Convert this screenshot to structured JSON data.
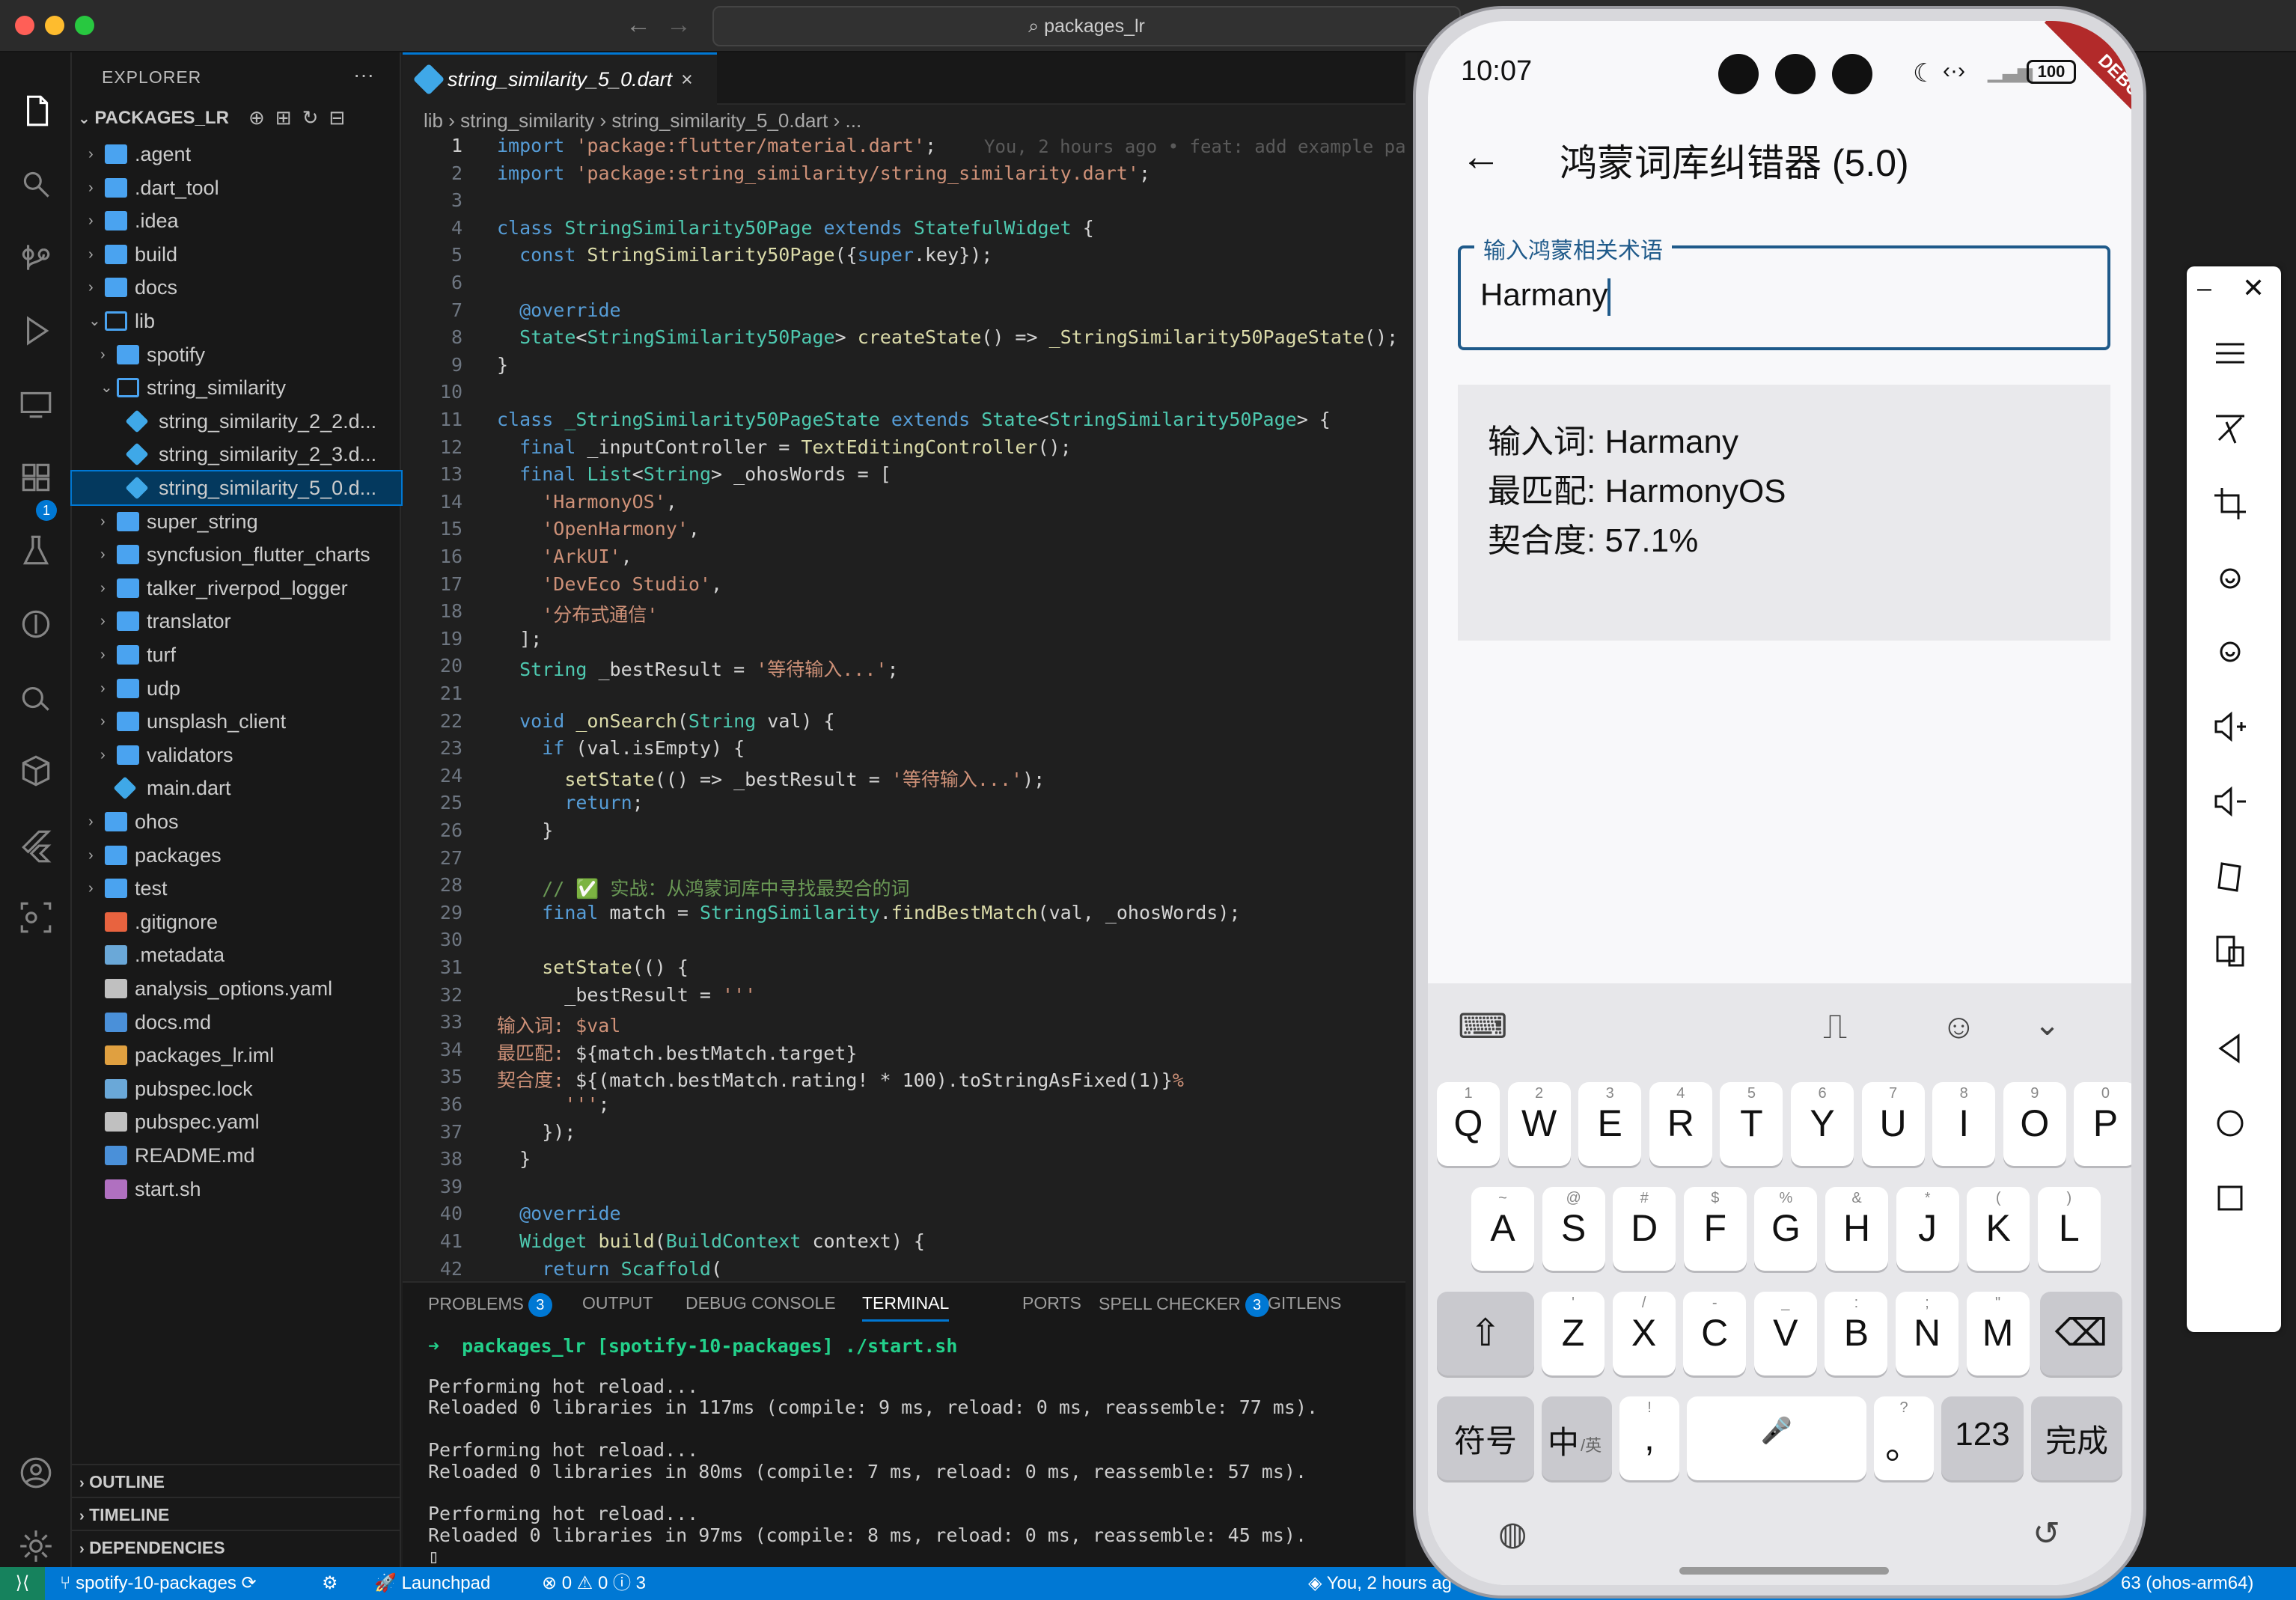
{
  "window": {
    "search": "packages_lr"
  },
  "activity_icons": [
    "files-icon",
    "search-icon",
    "source-control-icon",
    "run-debug-icon",
    "remote-explorer-icon",
    "extensions-icon",
    "testing-icon",
    "git-lens-icon",
    "docker-icon",
    "containers-icon",
    "flutter-icon",
    "scan-icon",
    "account-icon",
    "settings-icon"
  ],
  "activity_badge": "1",
  "sidebar": {
    "title": "EXPLORER",
    "root": "PACKAGES_LR",
    "tree": [
      {
        "label": ".agent",
        "depth": 0,
        "kind": "folder",
        "open": false
      },
      {
        "label": ".dart_tool",
        "depth": 0,
        "kind": "folder",
        "open": false
      },
      {
        "label": ".idea",
        "depth": 0,
        "kind": "folder",
        "open": false
      },
      {
        "label": "build",
        "depth": 0,
        "kind": "folder-gear",
        "open": false
      },
      {
        "label": "docs",
        "depth": 0,
        "kind": "folder",
        "open": false
      },
      {
        "label": "lib",
        "depth": 0,
        "kind": "folder",
        "open": true
      },
      {
        "label": "spotify",
        "depth": 1,
        "kind": "folder",
        "open": false
      },
      {
        "label": "string_similarity",
        "depth": 1,
        "kind": "folder",
        "open": true
      },
      {
        "label": "string_similarity_2_2.d...",
        "depth": 2,
        "kind": "dart"
      },
      {
        "label": "string_similarity_2_3.d...",
        "depth": 2,
        "kind": "dart"
      },
      {
        "label": "string_similarity_5_0.d...",
        "depth": 2,
        "kind": "dart",
        "selected": true
      },
      {
        "label": "super_string",
        "depth": 1,
        "kind": "folder",
        "open": false
      },
      {
        "label": "syncfusion_flutter_charts",
        "depth": 1,
        "kind": "folder",
        "open": false
      },
      {
        "label": "talker_riverpod_logger",
        "depth": 1,
        "kind": "folder",
        "open": false
      },
      {
        "label": "translator",
        "depth": 1,
        "kind": "folder",
        "open": false
      },
      {
        "label": "turf",
        "depth": 1,
        "kind": "folder",
        "open": false
      },
      {
        "label": "udp",
        "depth": 1,
        "kind": "folder",
        "open": false
      },
      {
        "label": "unsplash_client",
        "depth": 1,
        "kind": "folder",
        "open": false
      },
      {
        "label": "validators",
        "depth": 1,
        "kind": "folder",
        "open": false
      },
      {
        "label": "main.dart",
        "depth": 1,
        "kind": "dart"
      },
      {
        "label": "ohos",
        "depth": 0,
        "kind": "folder",
        "open": false
      },
      {
        "label": "packages",
        "depth": 0,
        "kind": "folder",
        "open": false
      },
      {
        "label": "test",
        "depth": 0,
        "kind": "folder",
        "open": false
      },
      {
        "label": ".gitignore",
        "depth": 0,
        "kind": "git"
      },
      {
        "label": ".metadata",
        "depth": 0,
        "kind": "file"
      },
      {
        "label": "analysis_options.yaml",
        "depth": 0,
        "kind": "yaml"
      },
      {
        "label": "docs.md",
        "depth": 0,
        "kind": "md"
      },
      {
        "label": "packages_lr.iml",
        "depth": 0,
        "kind": "xml"
      },
      {
        "label": "pubspec.lock",
        "depth": 0,
        "kind": "file"
      },
      {
        "label": "pubspec.yaml",
        "depth": 0,
        "kind": "yaml"
      },
      {
        "label": "README.md",
        "depth": 0,
        "kind": "md"
      },
      {
        "label": "start.sh",
        "depth": 0,
        "kind": "sh"
      }
    ],
    "sections": [
      "OUTLINE",
      "TIMELINE",
      "DEPENDENCIES"
    ]
  },
  "editor": {
    "tab": "string_similarity_5_0.dart",
    "breadcrumb": [
      "lib",
      "string_similarity",
      "string_similarity_5_0.dart",
      "..."
    ],
    "blame": "You, 2 hours ago • feat: add example pa",
    "lines": [
      [
        [
          "kw",
          "import "
        ],
        [
          "str",
          "'package:flutter/material.dart'"
        ],
        [
          "",
          "; "
        ]
      ],
      [
        [
          "kw",
          "import "
        ],
        [
          "str",
          "'package:string_similarity/string_similarity.dart'"
        ],
        [
          "",
          ";"
        ]
      ],
      [],
      [
        [
          "kw",
          "class "
        ],
        [
          "ty",
          "StringSimilarity50Page "
        ],
        [
          "kw",
          "extends "
        ],
        [
          "ty",
          "StatefulWidget "
        ],
        [
          "",
          "{"
        ]
      ],
      [
        [
          "",
          "  "
        ],
        [
          "kw",
          "const "
        ],
        [
          "fn",
          "StringSimilarity50Page"
        ],
        [
          "",
          "({"
        ],
        [
          "kw",
          "super"
        ],
        [
          "",
          ".key});"
        ]
      ],
      [],
      [
        [
          "",
          "  "
        ],
        [
          "ann",
          "@override"
        ]
      ],
      [
        [
          "",
          "  "
        ],
        [
          "ty",
          "State"
        ],
        [
          "",
          "<"
        ],
        [
          "ty",
          "StringSimilarity50Page"
        ],
        [
          "",
          "> "
        ],
        [
          "fn",
          "createState"
        ],
        [
          "",
          "() => "
        ],
        [
          "fn",
          "_StringSimilarity50PageState"
        ],
        [
          "",
          "();"
        ]
      ],
      [
        [
          "",
          "}"
        ]
      ],
      [],
      [
        [
          "kw",
          "class "
        ],
        [
          "ty",
          "_StringSimilarity50PageState "
        ],
        [
          "kw",
          "extends "
        ],
        [
          "ty",
          "State"
        ],
        [
          "",
          "<"
        ],
        [
          "ty",
          "StringSimilarity50Page"
        ],
        [
          "",
          "> {"
        ]
      ],
      [
        [
          "",
          "  "
        ],
        [
          "kw",
          "final "
        ],
        [
          "",
          "_inputController = "
        ],
        [
          "fn",
          "TextEditingController"
        ],
        [
          "",
          "();"
        ]
      ],
      [
        [
          "",
          "  "
        ],
        [
          "kw",
          "final "
        ],
        [
          "ty",
          "List"
        ],
        [
          "",
          "<"
        ],
        [
          "ty",
          "String"
        ],
        [
          "",
          "> _ohosWords = ["
        ]
      ],
      [
        [
          "",
          "    "
        ],
        [
          "str",
          "'HarmonyOS'"
        ],
        [
          "",
          ","
        ]
      ],
      [
        [
          "",
          "    "
        ],
        [
          "str",
          "'OpenHarmony'"
        ],
        [
          "",
          ","
        ]
      ],
      [
        [
          "",
          "    "
        ],
        [
          "str",
          "'ArkUI'"
        ],
        [
          "",
          ","
        ]
      ],
      [
        [
          "",
          "    "
        ],
        [
          "str",
          "'DevEco Studio'"
        ],
        [
          "",
          ","
        ]
      ],
      [
        [
          "",
          "    "
        ],
        [
          "str",
          "'分布式通信'"
        ]
      ],
      [
        [
          "",
          "  ];"
        ]
      ],
      [
        [
          "",
          "  "
        ],
        [
          "ty",
          "String "
        ],
        [
          "",
          "_bestResult = "
        ],
        [
          "str",
          "'等待输入...'"
        ],
        [
          "",
          ";"
        ]
      ],
      [],
      [
        [
          "",
          "  "
        ],
        [
          "kw",
          "void "
        ],
        [
          "fn",
          "_onSearch"
        ],
        [
          "",
          "("
        ],
        [
          "ty",
          "String "
        ],
        [
          "",
          "val) {"
        ]
      ],
      [
        [
          "",
          "    "
        ],
        [
          "kw",
          "if "
        ],
        [
          "",
          "(val.isEmpty) {"
        ]
      ],
      [
        [
          "",
          "      "
        ],
        [
          "fn",
          "setState"
        ],
        [
          "",
          "(() => _bestResult = "
        ],
        [
          "str",
          "'等待输入...'"
        ],
        [
          "",
          ");"
        ]
      ],
      [
        [
          "",
          "      "
        ],
        [
          "kw",
          "return"
        ],
        [
          "",
          ";"
        ]
      ],
      [
        [
          "",
          "    }"
        ]
      ],
      [],
      [
        [
          "",
          "    "
        ],
        [
          "cm",
          "// ✅ 实战：从鸿蒙词库中寻找最契合的词"
        ]
      ],
      [
        [
          "",
          "    "
        ],
        [
          "kw",
          "final "
        ],
        [
          "",
          "match = "
        ],
        [
          "ty",
          "StringSimilarity"
        ],
        [
          "",
          "."
        ],
        [
          "fn",
          "findBestMatch"
        ],
        [
          "",
          "(val, _ohosWords);"
        ]
      ],
      [],
      [
        [
          "",
          "    "
        ],
        [
          "fn",
          "setState"
        ],
        [
          "",
          "(() {"
        ]
      ],
      [
        [
          "",
          "      _bestResult = "
        ],
        [
          "str",
          "'''"
        ]
      ],
      [
        [
          "str",
          "输入词: $val"
        ]
      ],
      [
        [
          "str",
          "最匹配: "
        ],
        [
          "",
          "${match.bestMatch.target}"
        ]
      ],
      [
        [
          "str",
          "契合度: "
        ],
        [
          "",
          "${(match.bestMatch.rating! * 100).toStringAsFixed(1)}"
        ],
        [
          "str",
          "%"
        ]
      ],
      [
        [
          "",
          "      "
        ],
        [
          "str",
          "'''"
        ],
        [
          "",
          ";"
        ]
      ],
      [
        [
          "",
          "    });"
        ]
      ],
      [
        [
          "",
          "  }"
        ]
      ],
      [],
      [
        [
          "",
          "  "
        ],
        [
          "ann",
          "@override"
        ]
      ],
      [
        [
          "",
          "  "
        ],
        [
          "ty",
          "Widget "
        ],
        [
          "fn",
          "build"
        ],
        [
          "",
          "("
        ],
        [
          "ty",
          "BuildContext "
        ],
        [
          "",
          "context) {"
        ]
      ],
      [
        [
          "",
          "    "
        ],
        [
          "kw",
          "return "
        ],
        [
          "ty",
          "Scaffold"
        ],
        [
          "",
          "("
        ]
      ]
    ]
  },
  "panel": {
    "tabs": [
      {
        "label": "PROBLEMS",
        "badge": "3"
      },
      {
        "label": "OUTPUT"
      },
      {
        "label": "DEBUG CONSOLE"
      },
      {
        "label": "TERMINAL",
        "active": true
      },
      {
        "label": "PORTS"
      },
      {
        "label": "SPELL CHECKER",
        "badge": "3"
      },
      {
        "label": "GITLENS"
      }
    ],
    "prompt": "packages_lr [spotify-10-packages] ./start.sh",
    "output": [
      "Performing hot reload...",
      "Reloaded 0 libraries in 117ms (compile: 9 ms, reload: 0 ms, reassemble: 77 ms).",
      "",
      "Performing hot reload...",
      "Reloaded 0 libraries in 80ms (compile: 7 ms, reload: 0 ms, reassemble: 57 ms).",
      "",
      "Performing hot reload...",
      "Reloaded 0 libraries in 97ms (compile: 8 ms, reload: 0 ms, reassemble: 45 ms).",
      "▯"
    ]
  },
  "status": {
    "branch": "spotify-10-packages",
    "launchpad": "Launchpad",
    "problems": "⊗ 0 ⚠ 0 ⓘ 3",
    "blame": "You, 2 hours ag",
    "device": "63 (ohos-arm64)"
  },
  "phone": {
    "time": "10:07",
    "battery": "100",
    "debug_banner": "DEBUG",
    "app_title": "鸿蒙词库纠错器 (5.0)",
    "input_label": "输入鸿蒙相关术语",
    "input_value": "Harmany",
    "result_lines": [
      "输入词: Harmany",
      "最匹配: HarmonyOS",
      "契合度: 57.1%"
    ],
    "keyboard": {
      "row1": [
        [
          "Q",
          "1"
        ],
        [
          "W",
          "2"
        ],
        [
          "E",
          "3"
        ],
        [
          "R",
          "4"
        ],
        [
          "T",
          "5"
        ],
        [
          "Y",
          "6"
        ],
        [
          "U",
          "7"
        ],
        [
          "I",
          "8"
        ],
        [
          "O",
          "9"
        ],
        [
          "P",
          "0"
        ]
      ],
      "row2": [
        [
          "A",
          "~"
        ],
        [
          "S",
          "@"
        ],
        [
          "D",
          "#"
        ],
        [
          "F",
          "$"
        ],
        [
          "G",
          "%"
        ],
        [
          "H",
          "&"
        ],
        [
          "J",
          "*"
        ],
        [
          "K",
          "("
        ],
        [
          "L",
          ")"
        ]
      ],
      "row3": [
        [
          "Z",
          "'"
        ],
        [
          "X",
          "/"
        ],
        [
          "C",
          "-"
        ],
        [
          "V",
          "_"
        ],
        [
          "B",
          ":"
        ],
        [
          "N",
          ";"
        ],
        [
          "M",
          "\""
        ]
      ],
      "symbols": "符号",
      "lang_main": "中",
      "lang_sub": "/英",
      "comma": ",",
      "comma_hint": "!",
      "period": "。",
      "period_hint": "?",
      "num": "123",
      "done": "完成"
    }
  }
}
